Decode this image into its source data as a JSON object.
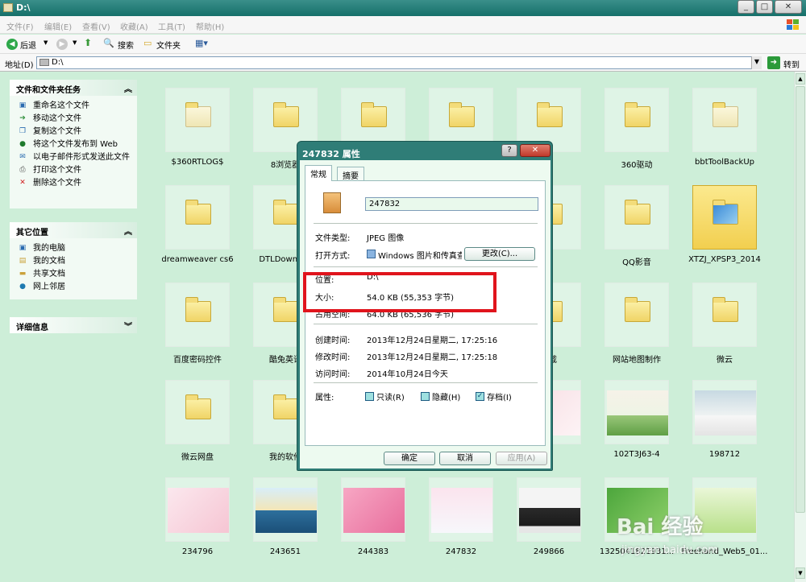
{
  "window": {
    "title": "D:\\"
  },
  "menu": {
    "items": [
      "文件(F)",
      "编辑(E)",
      "查看(V)",
      "收藏(A)",
      "工具(T)",
      "帮助(H)"
    ]
  },
  "toolbar": {
    "back": "后退",
    "search": "搜索",
    "folders": "文件夹"
  },
  "address": {
    "label": "地址(D)",
    "value": "D:\\",
    "go": "转到"
  },
  "sidebar": {
    "tasks": {
      "title": "文件和文件夹任务",
      "items": [
        "重命名这个文件",
        "移动这个文件",
        "复制这个文件",
        "将这个文件发布到 Web",
        "以电子邮件形式发送此文件",
        "打印这个文件",
        "删除这个文件"
      ]
    },
    "places": {
      "title": "其它位置",
      "items": [
        "我的电脑",
        "我的文档",
        "共享文档",
        "网上邻居"
      ]
    },
    "details": {
      "title": "详细信息"
    }
  },
  "files": [
    {
      "name": "$360RTLOG$",
      "type": "folder-pale"
    },
    {
      "name": "8浏览器",
      "type": "folder"
    },
    {
      "name": "",
      "type": "folder"
    },
    {
      "name": "",
      "type": "folder"
    },
    {
      "name": "",
      "type": "folder"
    },
    {
      "name": "360驱动",
      "type": "folder"
    },
    {
      "name": "bbtToolBackUp",
      "type": "folder-pale"
    },
    {
      "name": "dreamweaver cs6",
      "type": "folder"
    },
    {
      "name": "DTLDownLoa",
      "type": "folder"
    },
    {
      "name": "",
      "type": "folder"
    },
    {
      "name": "",
      "type": "folder"
    },
    {
      "name": "",
      "type": "folder"
    },
    {
      "name": "QQ影音",
      "type": "folder"
    },
    {
      "name": "XTZJ_XPSP3_2014",
      "type": "folder-special"
    },
    {
      "name": "百度密码控件",
      "type": "folder"
    },
    {
      "name": "酷兔英语",
      "type": "folder"
    },
    {
      "name": "",
      "type": "folder"
    },
    {
      "name": "",
      "type": "folder"
    },
    {
      "name": "下载",
      "type": "folder"
    },
    {
      "name": "网站地图制作",
      "type": "folder"
    },
    {
      "name": "微云",
      "type": "folder"
    },
    {
      "name": "微云网盘",
      "type": "folder"
    },
    {
      "name": "我的软件",
      "type": "folder"
    },
    {
      "name": "",
      "type": "folder"
    },
    {
      "name": "",
      "type": "folder"
    },
    {
      "name": "",
      "type": "photo-pink"
    },
    {
      "name": "102T3J63-4",
      "type": "photo-plant"
    },
    {
      "name": "198712",
      "type": "photo-white"
    },
    {
      "name": "234796",
      "type": "photo-gift"
    },
    {
      "name": "243651",
      "type": "photo-mailbox"
    },
    {
      "name": "244383",
      "type": "photo-pinkcard"
    },
    {
      "name": "247832",
      "type": "photo-eiffel"
    },
    {
      "name": "249866",
      "type": "photo-mug"
    },
    {
      "name": "1325041821931... ",
      "type": "photo-green"
    },
    {
      "name": "Freehand_Web5_01...",
      "type": "photo-girl"
    }
  ],
  "dialog": {
    "title": "247832 属性",
    "help": "?",
    "close": "✕",
    "tabs": [
      "常规",
      "摘要"
    ],
    "filename": "247832",
    "file_type_label": "文件类型:",
    "file_type_value": "JPEG 图像",
    "opens_with_label": "打开方式:",
    "opens_with_value": "Windows 图片和传真查",
    "change_button": "更改(C)...",
    "location_label": "位置:",
    "location_value": "D:\\",
    "size_label": "大小:",
    "size_value": "54.0 KB (55,353 字节)",
    "size_on_disk_label": "占用空间:",
    "size_on_disk_value": "64.0 KB (65,536 字节)",
    "created_label": "创建时间:",
    "created_value": "2013年12月24日星期二, 17:25:16",
    "modified_label": "修改时间:",
    "modified_value": "2013年12月24日星期二, 17:25:18",
    "accessed_label": "访问时间:",
    "accessed_value": "2014年10月24日今天",
    "attributes_label": "属性:",
    "readonly": "只读(R)",
    "hidden": "隐藏(H)",
    "archive": "存档(I)",
    "archive_checked": true,
    "ok": "确定",
    "cancel": "取消",
    "apply": "应用(A)"
  },
  "watermark": {
    "line1": "Bai 经验",
    "line2": "jingyan.baidu.com"
  }
}
